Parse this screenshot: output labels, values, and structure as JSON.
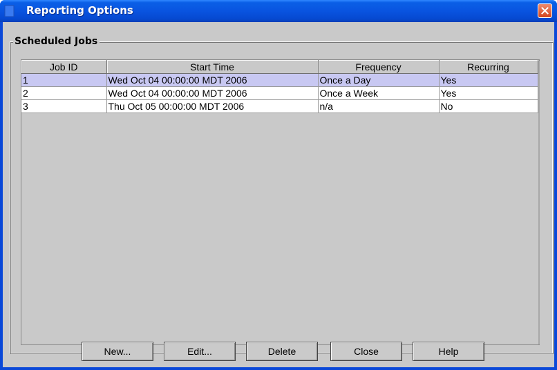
{
  "window": {
    "title": "Reporting Options"
  },
  "group": {
    "title": "Scheduled Jobs"
  },
  "table": {
    "columns": [
      "Job ID",
      "Start Time",
      "Frequency",
      "Recurring"
    ],
    "rows": [
      [
        "1",
        "Wed Oct 04 00:00:00 MDT 2006",
        "Once a Day",
        "Yes"
      ],
      [
        "2",
        "Wed Oct 04 00:00:00 MDT 2006",
        "Once a Week",
        "Yes"
      ],
      [
        "3",
        "Thu Oct 05 00:00:00 MDT 2006",
        "n/a",
        "No"
      ]
    ],
    "selected_row": "1"
  },
  "buttons": {
    "new": "New...",
    "edit": "Edit...",
    "delete": "Delete",
    "close": "Close",
    "help": "Help"
  },
  "colors": {
    "titlebar": "#0954e0",
    "client_bg": "#c9c9c9",
    "selection": "#c8c8f2",
    "close_button": "#d2451f"
  }
}
